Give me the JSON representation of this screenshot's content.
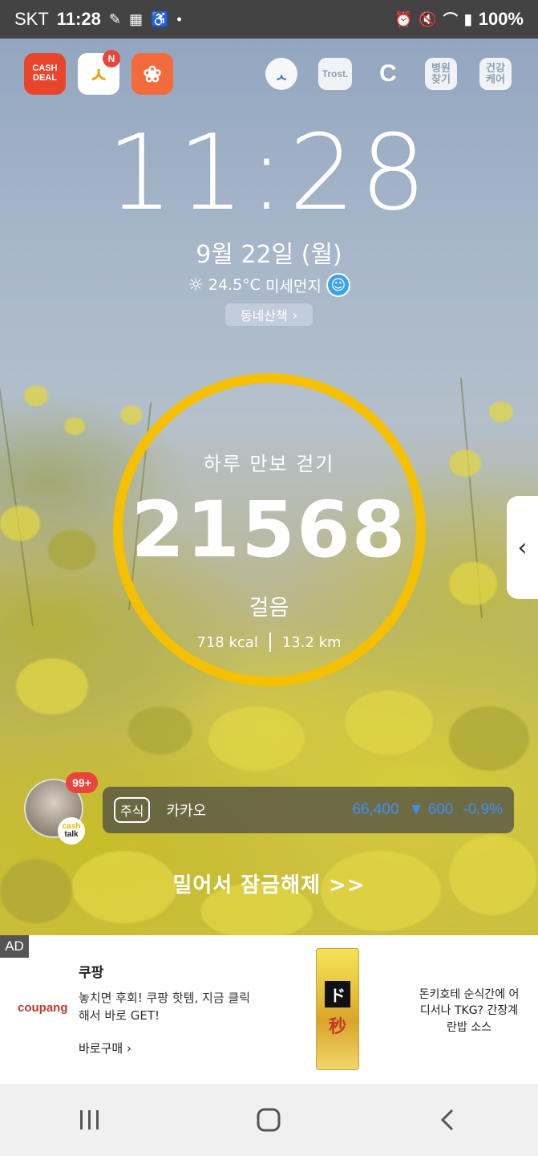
{
  "status_bar": {
    "carrier": "SKT",
    "time": "11:28",
    "battery": "100%",
    "left_icons": [
      "edit-pen-icon",
      "ar-icon",
      "accessibility-icon",
      "dot-icon"
    ],
    "right_icons": [
      "alarm-icon",
      "mute-icon",
      "wifi-icon",
      "signal-icon"
    ]
  },
  "shortcuts": {
    "left": [
      {
        "name": "cash-deal-app",
        "label": "CASH DEAL",
        "color": "#e8452c"
      },
      {
        "name": "nav-app",
        "label": "N",
        "color": "#ffffff"
      },
      {
        "name": "paw-app",
        "label": "",
        "color": "#f36a3b"
      }
    ],
    "right": [
      {
        "name": "cat-app",
        "label": ""
      },
      {
        "name": "trost-app",
        "label": "Trost."
      },
      {
        "name": "c-app",
        "label": "C"
      },
      {
        "name": "hospital-app",
        "label": "병원\n찾기"
      },
      {
        "name": "health-app",
        "label": "건강\n케어"
      }
    ]
  },
  "lock": {
    "clock": "11:28",
    "date": "9월 22일 (월)",
    "temperature": "24.5°C",
    "dust_label": "미세먼지",
    "walk_label": "동네산책"
  },
  "pedometer": {
    "title": "하루 만보 걷기",
    "steps": "21568",
    "unit": "걸음",
    "kcal": "718 kcal",
    "distance": "13.2 km",
    "ring_color": "#f5c000"
  },
  "cashtalk": {
    "badge": "99+",
    "label_top": "cash",
    "label_bottom": "talk"
  },
  "stock": {
    "tag": "주식",
    "name": "카카오",
    "price": "66,400",
    "change": "▼ 600",
    "percent": "-0.9%",
    "color": "#3d8ff2"
  },
  "unlock_text": "밀어서 잠금해제 >>",
  "ad": {
    "tag": "AD",
    "brand": "coupang",
    "title": "쿠팡",
    "description": "놓치면 후회! 쿠팡 핫템, 지금 클릭해서 바로 GET!",
    "cta": "바로구매",
    "product_label": "ド",
    "product_text": "돈키호테 순식간에 어디서나 TKG? 간장계란밥 소스"
  },
  "navbar": {
    "recent": "recent-apps-icon",
    "home": "home-icon",
    "back": "back-icon"
  }
}
